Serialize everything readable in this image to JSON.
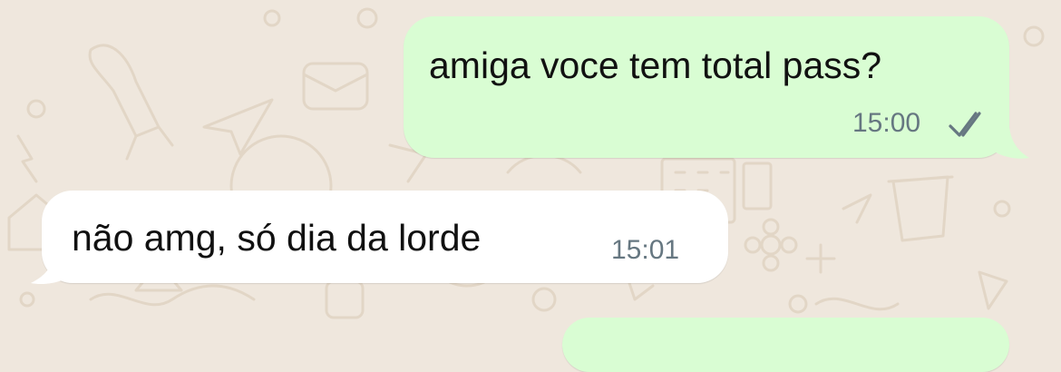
{
  "chat": {
    "messages": [
      {
        "direction": "outgoing",
        "text": "amiga voce tem total pass?",
        "time": "15:00",
        "status_icon": "double-check-icon"
      },
      {
        "direction": "incoming",
        "text": "não amg, só dia da lorde",
        "time": "15:01"
      }
    ]
  },
  "colors": {
    "wallpaper": "#efe7dd",
    "wallpaper_doodle": "#e2d6c6",
    "outgoing_bubble": "#d9fdd3",
    "incoming_bubble": "#ffffff",
    "timestamp": "#667781",
    "message_text": "#111111"
  }
}
